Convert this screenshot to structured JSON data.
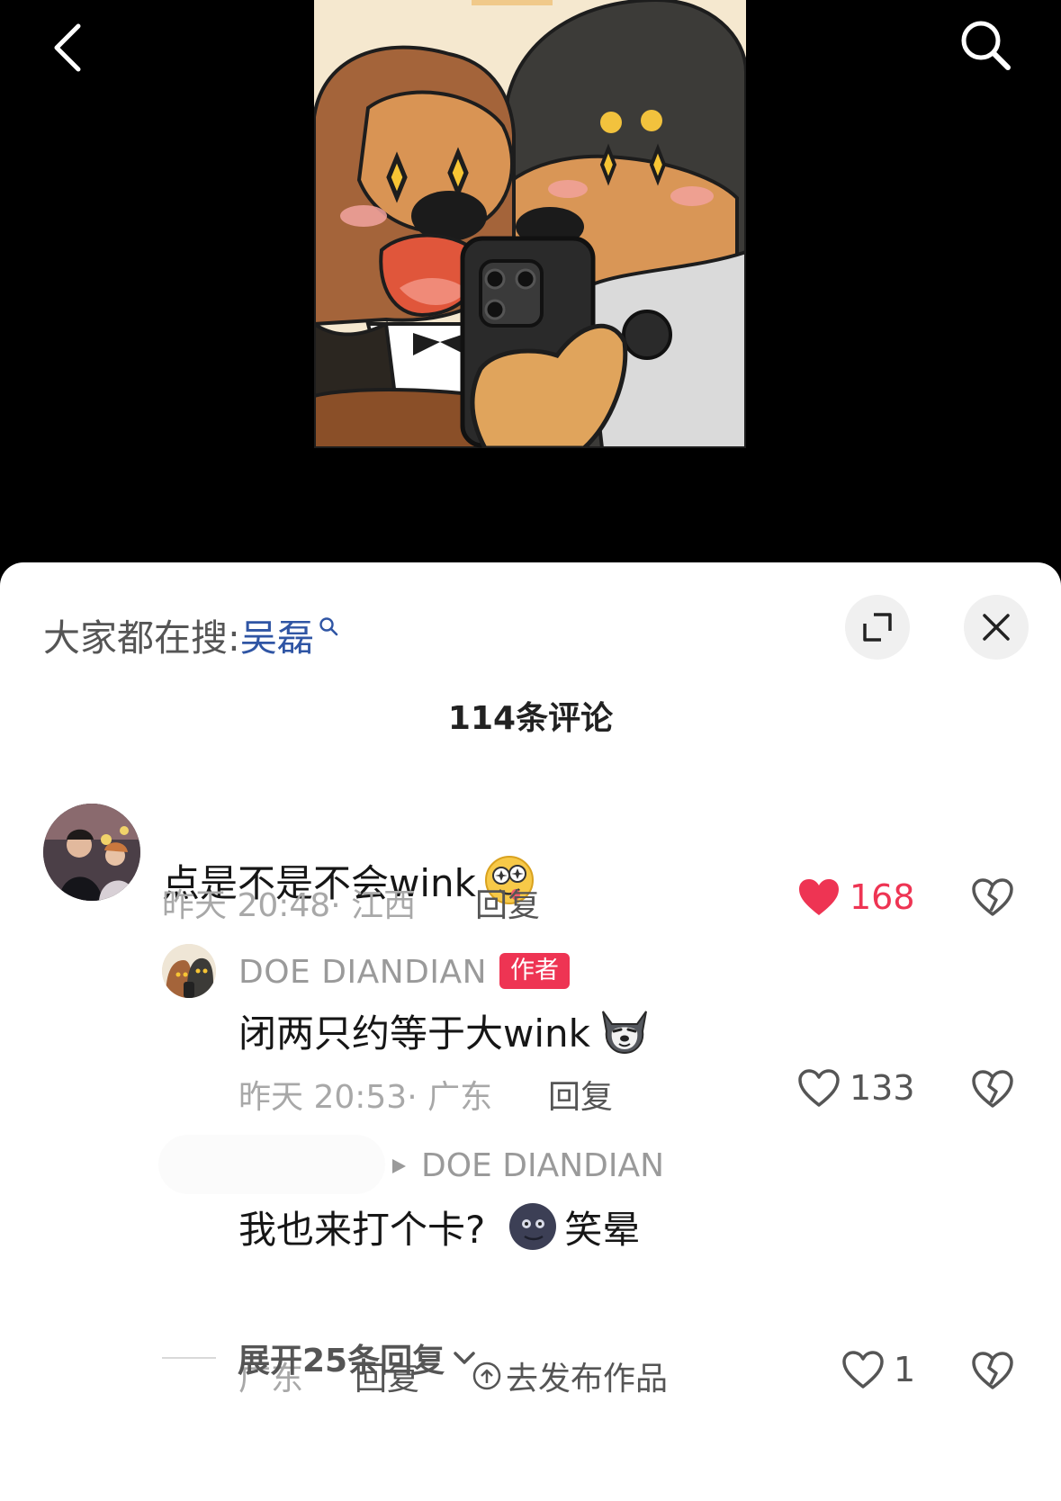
{
  "nav": {
    "back_icon": "chevron-left-icon",
    "search_icon": "search-icon"
  },
  "sheet": {
    "search_hint": {
      "label": "大家都在搜:",
      "term": "吴磊"
    },
    "count_label": "114条评论"
  },
  "comments": [
    {
      "text": "点是不是不会wink",
      "emoji": "starry-eyed-emoji",
      "time": "昨天 20:48",
      "location": "江西",
      "reply_label": "回复",
      "likes": "168",
      "liked": true
    }
  ],
  "replies": [
    {
      "author": "DOE DIANDIAN",
      "badge": "作者",
      "text": "闭两只约等于大wink",
      "emoji": "husky-emoji",
      "time": "昨天 20:53",
      "location": "广东",
      "reply_label": "回复",
      "likes": "133"
    },
    {
      "reply_to": "DOE DIANDIAN",
      "text": "我也来打个卡?",
      "emoji": "moon-face-emoji",
      "emoji_text": "笑晕",
      "location": "广东",
      "reply_label": "回复",
      "publish_label": "去发布作品",
      "likes": "1"
    }
  ],
  "expand_label": "展开25条回复",
  "colors": {
    "accent_red": "#ee3453",
    "link_blue": "#2f55a4"
  }
}
